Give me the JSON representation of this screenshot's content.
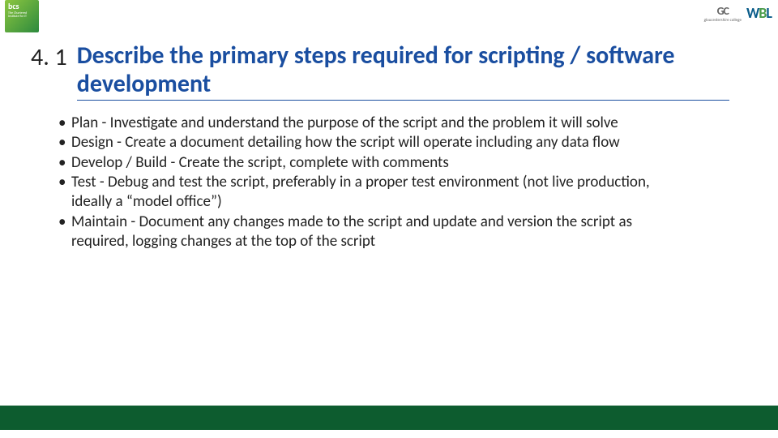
{
  "header": {
    "bcs_logo_text": "bcs",
    "bcs_logo_sub": "The Chartered Institute for IT",
    "gc_text": "GC",
    "gc_sub": "gloucestershire college",
    "wbl_w": "W",
    "wbl_b": "B",
    "wbl_l": "L"
  },
  "section_number": "4. 1",
  "title": "Describe the primary steps required for scripting / software development",
  "bullets": [
    "Plan - Investigate and understand the purpose of the script and the problem it will solve",
    "Design - Create a document detailing how the script will operate including any data flow",
    "Develop / Build - Create the script, complete with comments",
    "Test - Debug and test the script, preferably in a proper test environment (not live production, ideally a “model office”)",
    "Maintain - Document any changes made to the script and update and version the script as required, logging changes at the top of the script"
  ]
}
